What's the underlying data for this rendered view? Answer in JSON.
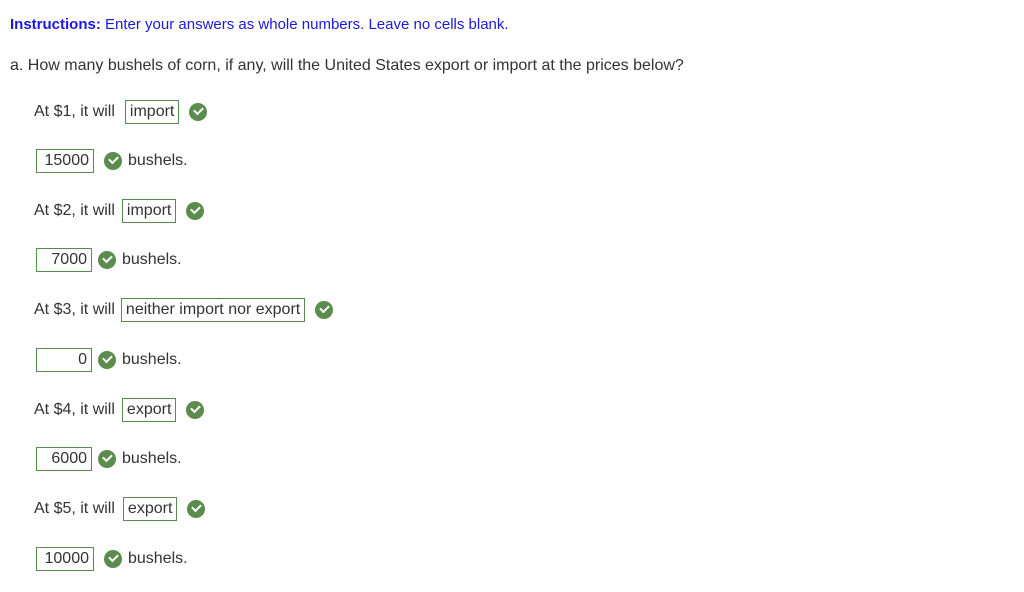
{
  "instructions": {
    "label": "Instructions:",
    "text": " Enter your answers as whole numbers. Leave no cells blank."
  },
  "question": "a. How many bushels of corn, if any, will the United States export or import at the prices below?",
  "unit_label": "bushels.",
  "rows": [
    {
      "prompt": "At $1, it will",
      "choice": "import",
      "amount": "15000",
      "status": "correct"
    },
    {
      "prompt": "At $2, it will",
      "choice": "import",
      "amount": "7000",
      "status": "correct"
    },
    {
      "prompt": "At $3, it will",
      "choice": "neither import nor export",
      "amount": "0",
      "status": "correct"
    },
    {
      "prompt": "At $4, it will",
      "choice": "export",
      "amount": "6000",
      "status": "correct"
    },
    {
      "prompt": "At $5, it will",
      "choice": "export",
      "amount": "10000",
      "status": "correct"
    }
  ],
  "colors": {
    "instruction": "#1a1adb",
    "correct": "#5b8c4e",
    "box_border": "#5a8a54"
  }
}
